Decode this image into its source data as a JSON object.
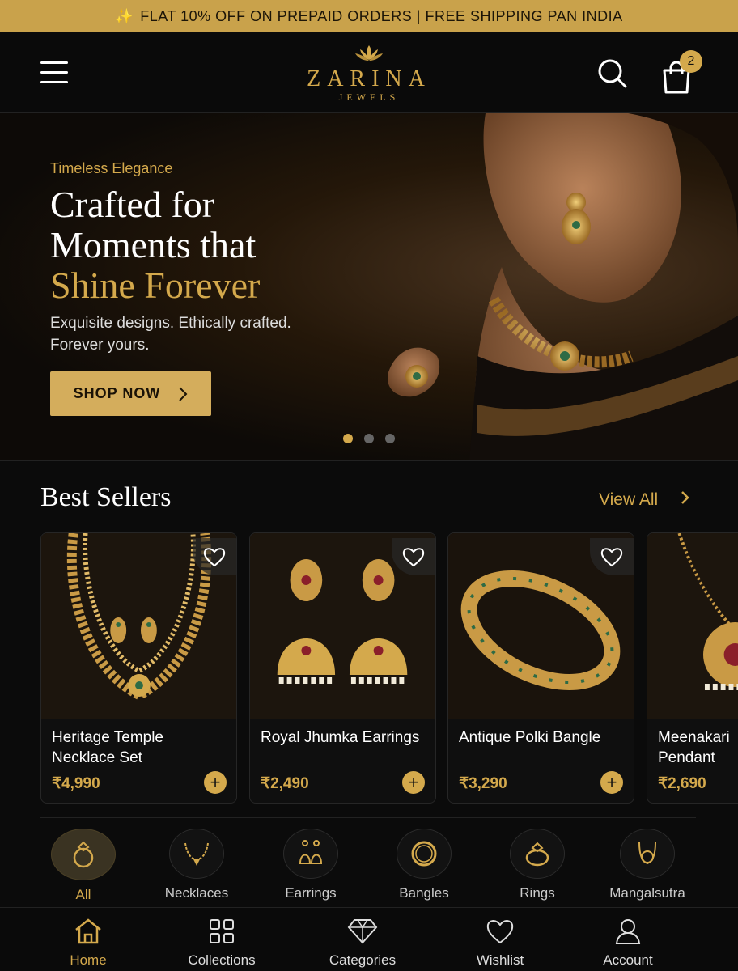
{
  "promo": {
    "icon": "sparkle-icon",
    "text": "FLAT 10% OFF ON PREPAID ORDERS | FREE SHIPPING PAN INDIA"
  },
  "header": {
    "brand": "ZARINA",
    "brand_sub": "JEWELS",
    "cart_count": "2"
  },
  "hero": {
    "eyebrow": "Timeless Elegance",
    "headline_1": "Crafted for",
    "headline_2": "Moments that",
    "headline_3": "Shine Forever",
    "subtext": "Exquisite designs. Ethically crafted. Forever yours.",
    "cta": "SHOP NOW",
    "slides": 3,
    "active_slide": 1
  },
  "best_sellers": {
    "title": "Best Sellers",
    "view_all": "View All",
    "products": [
      {
        "name": "Heritage Temple Necklace Set",
        "price": "₹4,990"
      },
      {
        "name": "Royal Jhumka Earrings",
        "price": "₹2,490"
      },
      {
        "name": "Antique Polki Bangle",
        "price": "₹3,290"
      },
      {
        "name": "Meenakari Pendant",
        "price": "₹2,690"
      }
    ]
  },
  "categories": [
    {
      "label": "All",
      "icon": "ring-icon"
    },
    {
      "label": "Necklaces",
      "icon": "necklace-icon"
    },
    {
      "label": "Earrings",
      "icon": "earrings-icon"
    },
    {
      "label": "Bangles",
      "icon": "bangle-icon"
    },
    {
      "label": "Rings",
      "icon": "ring-icon"
    },
    {
      "label": "Mangalsutra",
      "icon": "mangalsutra-icon"
    }
  ],
  "tabs": [
    {
      "label": "Home",
      "icon": "home-icon"
    },
    {
      "label": "Collections",
      "icon": "grid-icon"
    },
    {
      "label": "Categories",
      "icon": "diamond-icon"
    },
    {
      "label": "Wishlist",
      "icon": "heart-icon"
    },
    {
      "label": "Account",
      "icon": "user-icon"
    }
  ],
  "colors": {
    "gold": "#d4a94c",
    "background": "#0b0b0b",
    "promo_bar": "#c9a24b"
  }
}
